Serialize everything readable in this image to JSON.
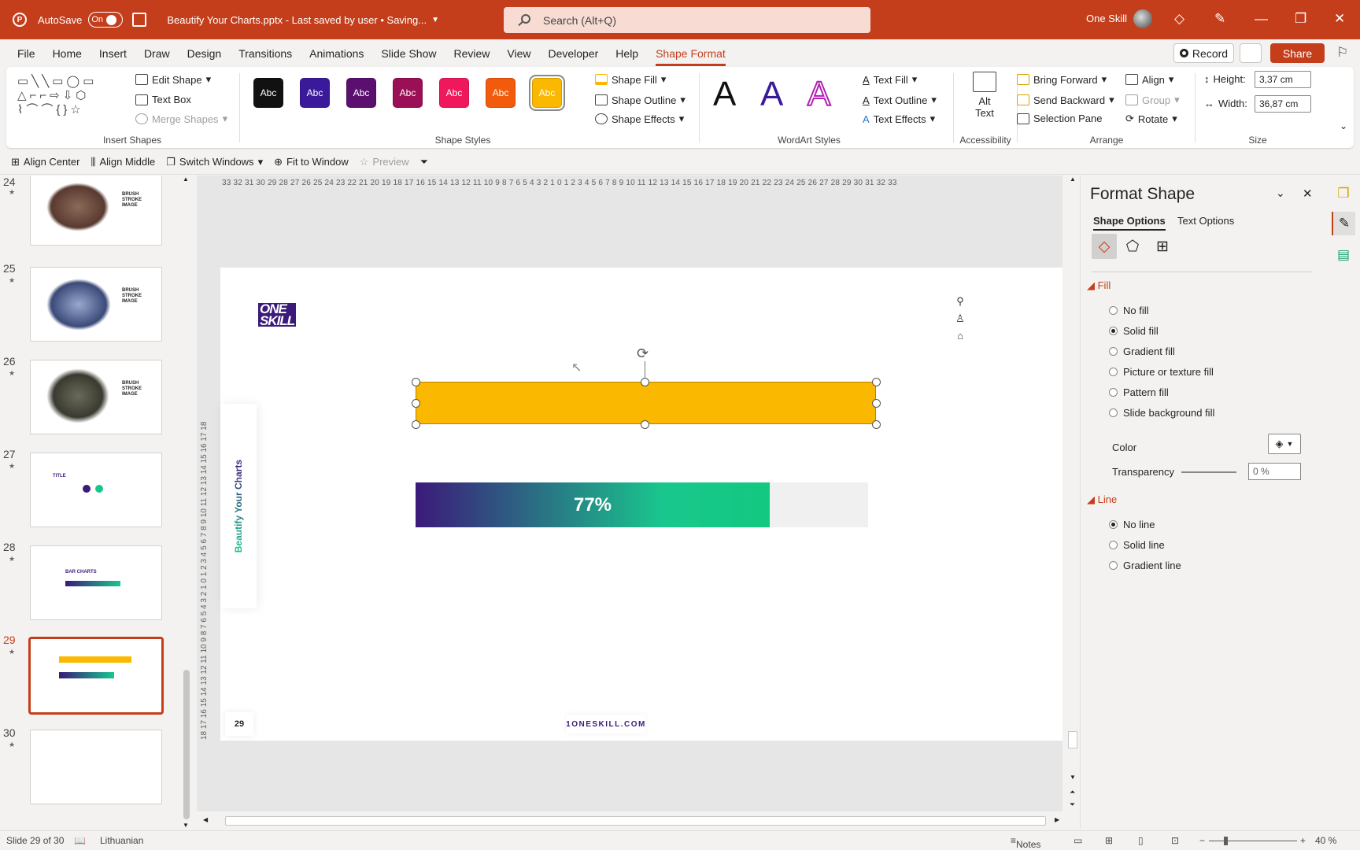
{
  "titlebar": {
    "autosave": "AutoSave",
    "toggle": "On",
    "doc_title": "Beautify Your Charts.pptx  -  Last saved by user • Saving...",
    "search_placeholder": "Search (Alt+Q)",
    "user": "One Skill"
  },
  "menu": [
    "File",
    "Home",
    "Insert",
    "Draw",
    "Design",
    "Transitions",
    "Animations",
    "Slide Show",
    "Review",
    "View",
    "Developer",
    "Help",
    "Shape Format"
  ],
  "menu_active": "Shape Format",
  "actions": {
    "record": "Record",
    "share": "Share"
  },
  "ribbon": {
    "insert_shapes": {
      "label": "Insert Shapes",
      "edit_shape": "Edit Shape",
      "text_box": "Text Box",
      "merge_shapes": "Merge Shapes"
    },
    "shape_styles": {
      "label": "Shape Styles",
      "sample": "Abc",
      "colors": [
        "#111111",
        "#3a1a9a",
        "#5b1070",
        "#9a0f55",
        "#f0185c",
        "#f25a0c",
        "#fbb800"
      ],
      "fill": "Shape Fill",
      "outline": "Shape Outline",
      "effects": "Shape Effects"
    },
    "wordart": {
      "label": "WordArt Styles",
      "letter": "A",
      "text_fill": "Text Fill",
      "text_outline": "Text Outline",
      "text_effects": "Text Effects"
    },
    "accessibility": {
      "label": "Accessibility",
      "alt_text_1": "Alt",
      "alt_text_2": "Text"
    },
    "arrange": {
      "label": "Arrange",
      "bring_forward": "Bring Forward",
      "send_backward": "Send Backward",
      "selection_pane": "Selection Pane",
      "align": "Align",
      "group": "Group",
      "rotate": "Rotate"
    },
    "size": {
      "label": "Size",
      "height_label": "Height:",
      "height": "3,37 cm",
      "width_label": "Width:",
      "width": "36,87 cm"
    }
  },
  "qat": {
    "align_center": "Align Center",
    "align_middle": "Align Middle",
    "switch_windows": "Switch Windows",
    "fit_window": "Fit to Window",
    "preview": "Preview"
  },
  "thumbnails": [
    {
      "num": "24",
      "caption": "BRUSH STROKE IMAGE"
    },
    {
      "num": "25",
      "caption": "BRUSH STROKE IMAGE"
    },
    {
      "num": "26",
      "caption": "BRUSH STROKE IMAGE"
    },
    {
      "num": "27",
      "caption": "TITLE"
    },
    {
      "num": "28",
      "caption": "BAR CHARTS"
    },
    {
      "num": "29",
      "caption": ""
    },
    {
      "num": "30",
      "caption": ""
    }
  ],
  "ruler": {
    "h": "33 32 31 30 29 28 27 26 25 24 23 22 21 20 19 18 17 16 15 14 13 12 11 10 9 8 7 6 5 4 3 2 1 0 1 2 3 4 5 6 7 8 9 10 11 12 13 14 15 16 17 18 19 20 21 22 23 24 25 26 27 28 29 30 31 32 33",
    "v": "18 17 16 15 14 13 12 11 10 9 8 7 6 5 4 3 2 1 0 1 2 3 4 5 6 7 8 9 10 11 12 13 14 15 16 17 18"
  },
  "slide": {
    "logo_1": "ONE",
    "logo_2": "SKILL",
    "side_title": "Beautify Your Charts",
    "progress_label": "77%",
    "progress_value": 0.77,
    "page": "29",
    "url": "1ONESKILL.COM",
    "bar_color": "#fbb800"
  },
  "format_panel": {
    "title": "Format Shape",
    "tab_shape": "Shape Options",
    "tab_text": "Text Options",
    "fill_label": "Fill",
    "fill_options": [
      "No fill",
      "Solid fill",
      "Gradient fill",
      "Picture or texture fill",
      "Pattern fill",
      "Slide background fill"
    ],
    "fill_selected": 1,
    "color_label": "Color",
    "transparency_label": "Transparency",
    "transparency": "0 %",
    "line_label": "Line",
    "line_options": [
      "No line",
      "Solid line",
      "Gradient line"
    ],
    "line_selected": 0
  },
  "status": {
    "slide": "Slide 29 of 30",
    "language": "Lithuanian",
    "notes": "Notes",
    "zoom": "40 %"
  }
}
